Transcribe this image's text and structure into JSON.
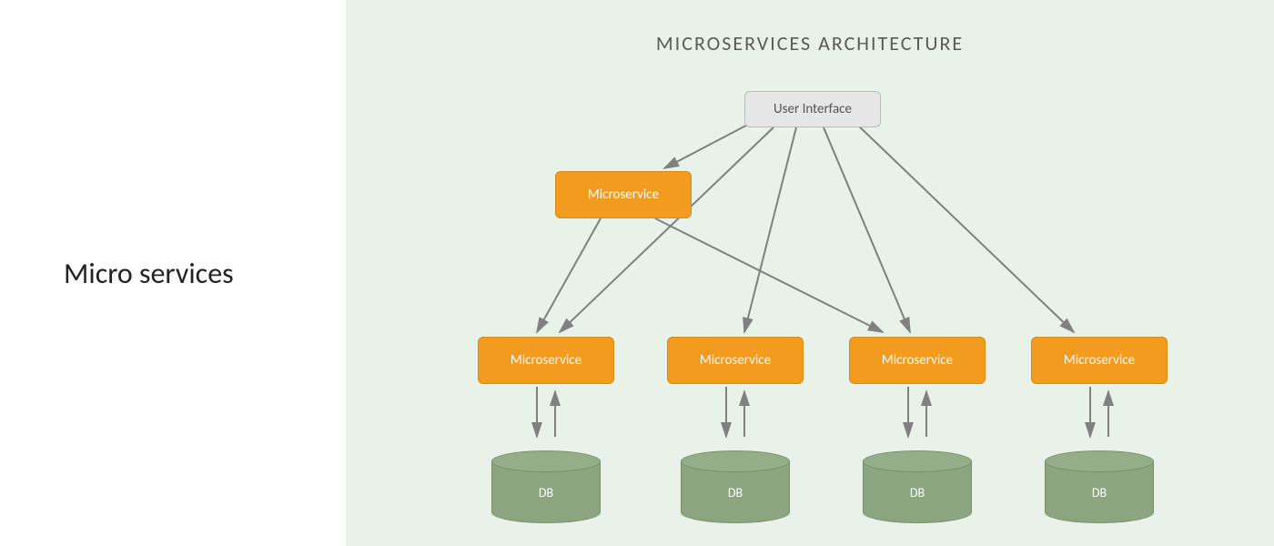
{
  "left": {
    "title": "Micro services"
  },
  "diagram": {
    "title": "MICROSERVICES ARCHITECTURE",
    "nodes": {
      "ui": {
        "label": "User Interface"
      },
      "ms_top": {
        "label": "Microservice"
      },
      "ms_row": [
        {
          "label": "Microservice"
        },
        {
          "label": "Microservice"
        },
        {
          "label": "Microservice"
        },
        {
          "label": "Microservice"
        }
      ],
      "db_row": [
        {
          "label": "DB"
        },
        {
          "label": "DB"
        },
        {
          "label": "DB"
        },
        {
          "label": "DB"
        }
      ]
    },
    "connections": [
      {
        "from": "ui",
        "to": "ms_top"
      },
      {
        "from": "ui",
        "to": "ms_row.0"
      },
      {
        "from": "ui",
        "to": "ms_row.1"
      },
      {
        "from": "ui",
        "to": "ms_row.2"
      },
      {
        "from": "ui",
        "to": "ms_row.3"
      },
      {
        "from": "ms_top",
        "to": "ms_row.0"
      },
      {
        "from": "ms_top",
        "to": "ms_row.2"
      },
      {
        "from": "ms_row.0",
        "to_from": "db_row.0"
      },
      {
        "from": "ms_row.1",
        "to_from": "db_row.1"
      },
      {
        "from": "ms_row.2",
        "to_from": "db_row.2"
      },
      {
        "from": "ms_row.3",
        "to_from": "db_row.3"
      }
    ],
    "colors": {
      "microservice": "#f29b1f",
      "ui_box": "#e6e6e6",
      "db": "#8ca580",
      "arrow": "#808080",
      "bg": "#e8f2e8"
    }
  }
}
